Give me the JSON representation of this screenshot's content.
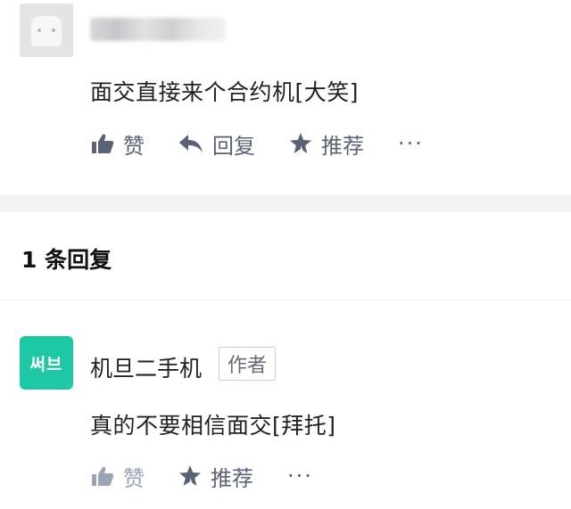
{
  "comment": {
    "text": "面交直接来个合约机[大笑]",
    "actions": {
      "like_label": "赞",
      "reply_label": "回复",
      "recommend_label": "推荐",
      "more_label": "···"
    }
  },
  "replies": {
    "header": "1 条回复",
    "items": [
      {
        "avatar_text": "써브",
        "name": "机旦二手机",
        "badge": "作者",
        "text": "真的不要相信面交[拜托]",
        "actions": {
          "like_label": "赞",
          "recommend_label": "推荐",
          "more_label": "···"
        }
      }
    ]
  },
  "colors": {
    "action_icon": "#5a6277",
    "action_muted": "#9aa3b8",
    "avatar_green": "#1ec8a5",
    "divider": "#f3f3f5"
  },
  "icons": [
    "thumbs-up-icon",
    "reply-arrow-icon",
    "star-icon"
  ]
}
